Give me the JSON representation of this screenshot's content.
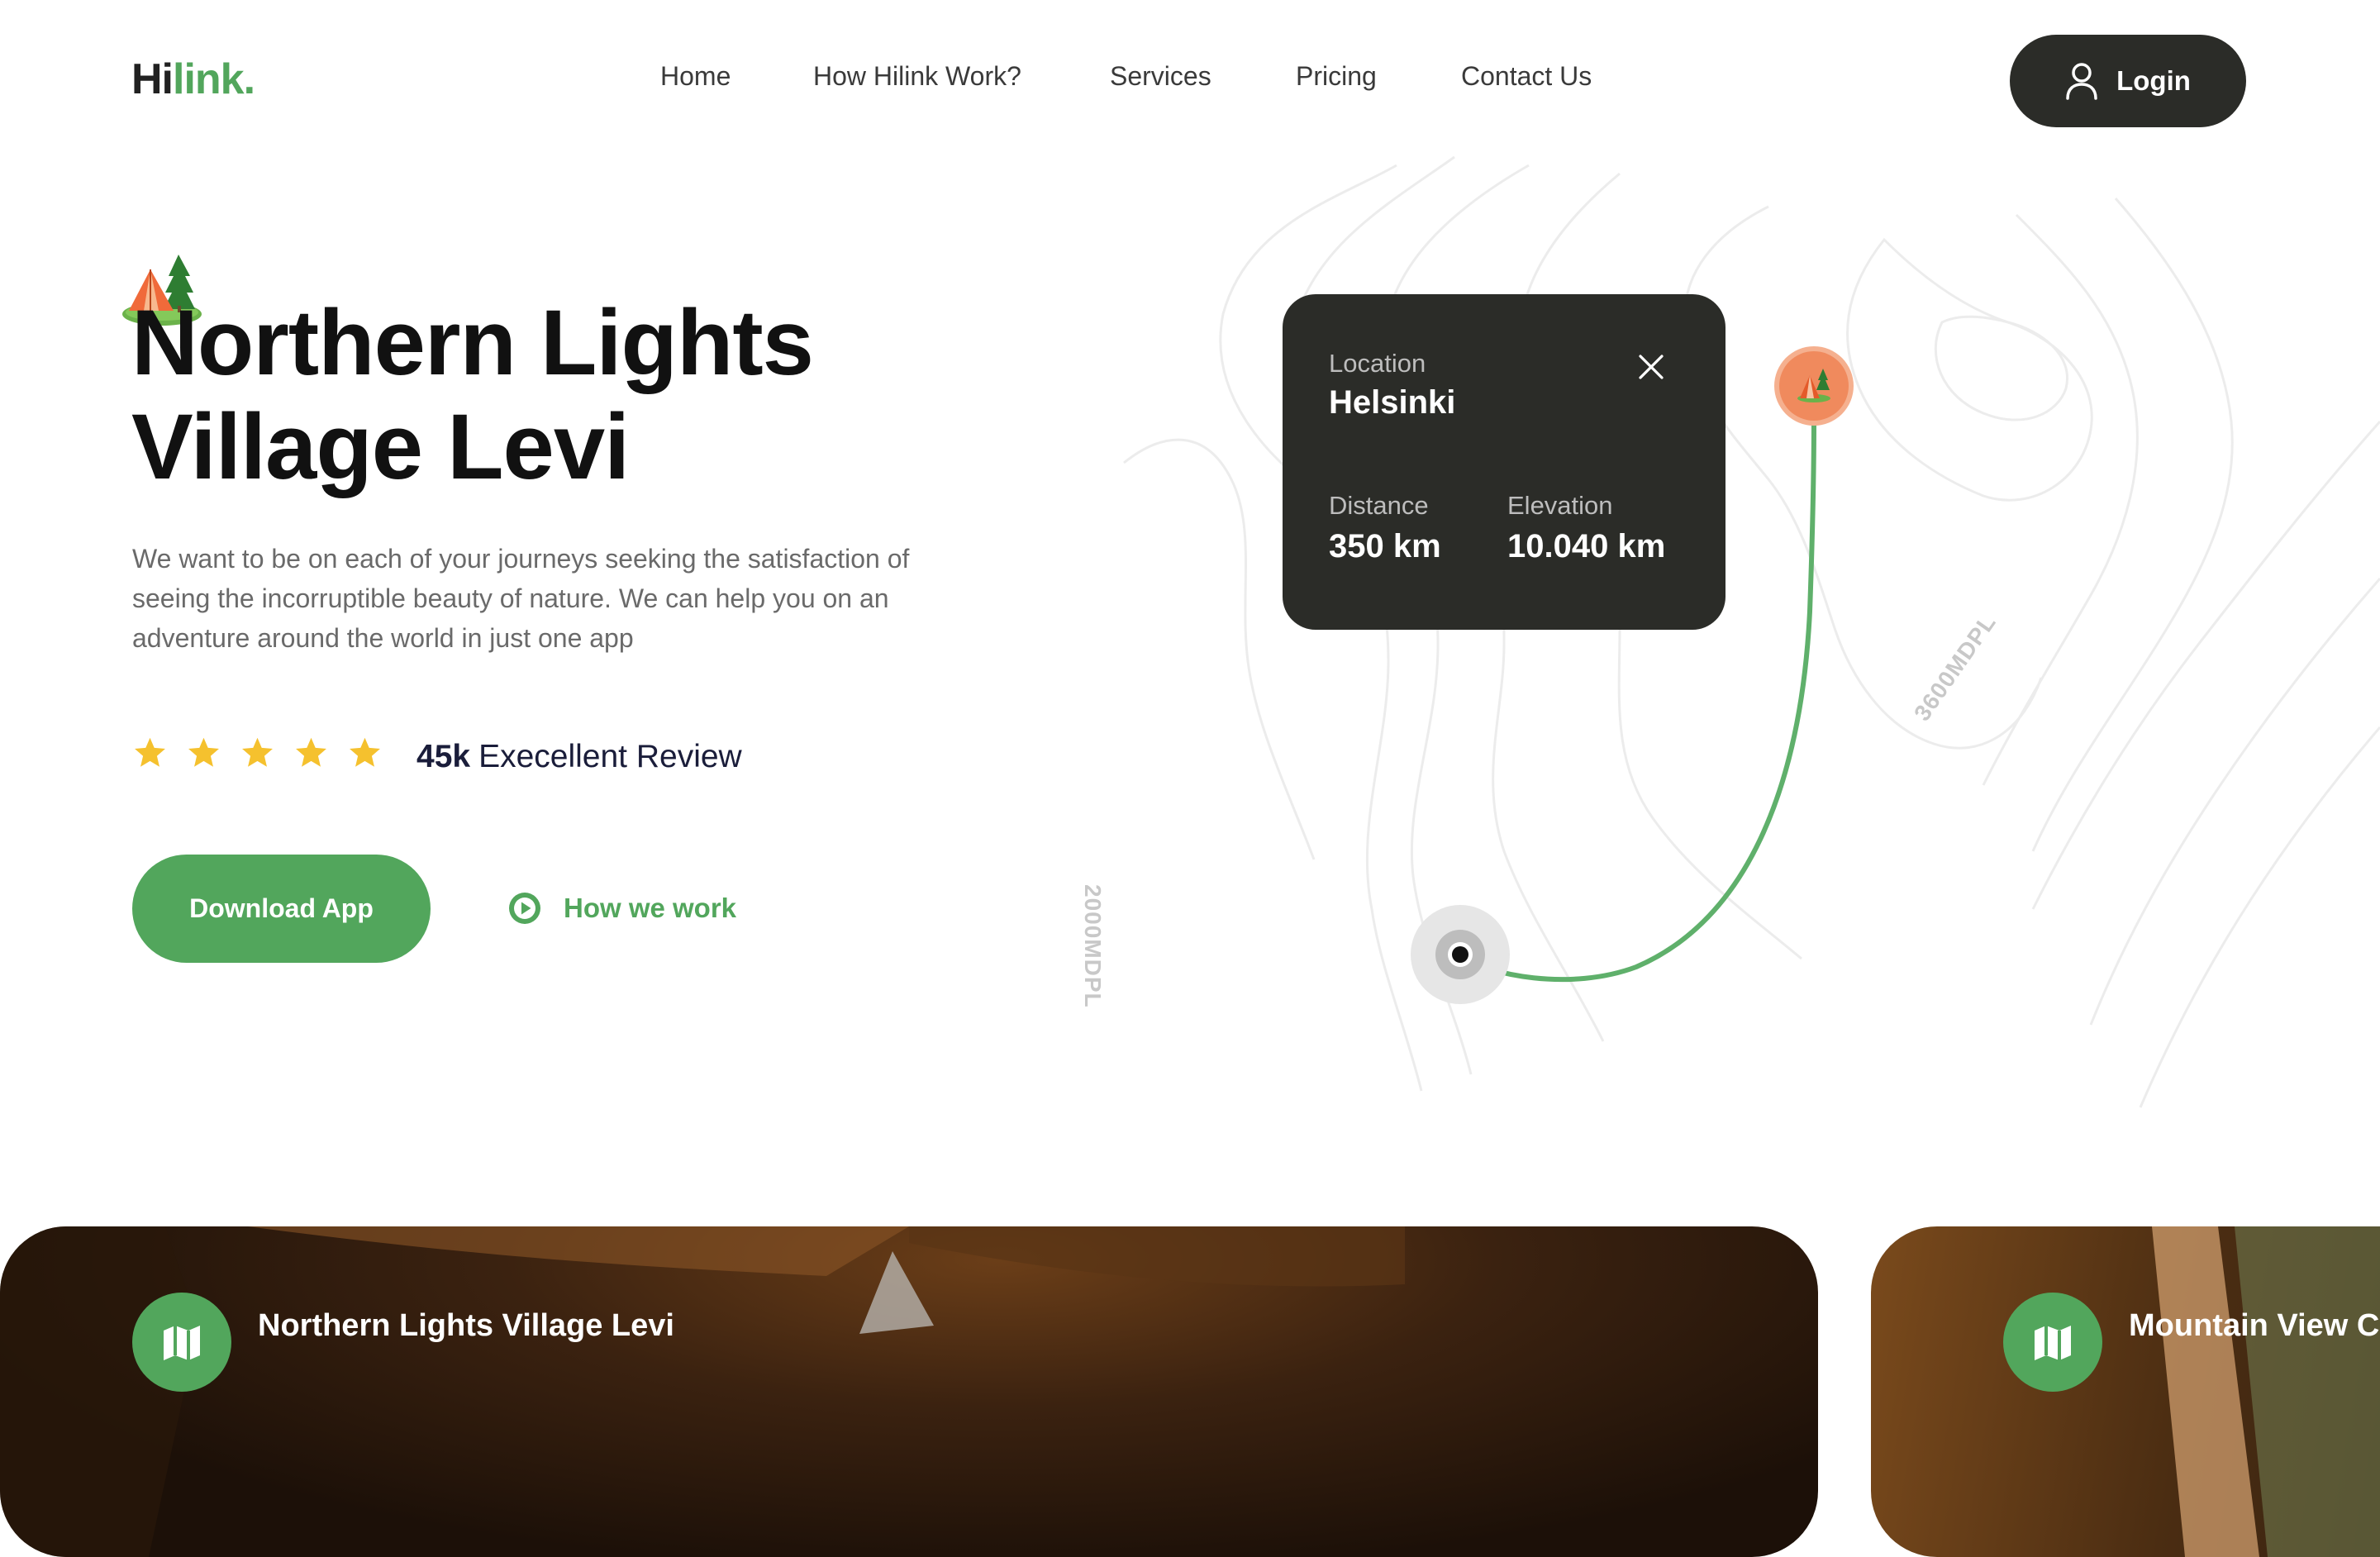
{
  "header": {
    "logo_hi": "Hi",
    "logo_link": "link.",
    "nav": [
      "Home",
      "How Hilink Work?",
      "Services",
      "Pricing",
      "Contact Us"
    ],
    "login_label": "Login"
  },
  "hero": {
    "title_line1": "Northern Lights",
    "title_line2": "Village Levi",
    "description": "We want to be on each of your journeys seeking the satisfaction of seeing the incorruptible beauty of nature. We can help you on an adventure around the world in just one app",
    "rating_stars": 5,
    "review_count": "45k",
    "review_text": "Execellent Review",
    "download_label": "Download App",
    "how_we_work_label": "How we work"
  },
  "map": {
    "elevation_labels": [
      "2000MDPL",
      "3600MDPL"
    ],
    "card": {
      "location_label": "Location",
      "location_value": "Helsinki",
      "distance_label": "Distance",
      "distance_value": "350 km",
      "elevation_label": "Elevation",
      "elevation_value": "10.040 km"
    },
    "pin_icon": "tent-icon"
  },
  "cards": [
    {
      "title": "Northern Lights Village Levi",
      "icon": "map-icon"
    },
    {
      "title": "Mountain View Ca",
      "icon": "map-icon"
    }
  ],
  "colors": {
    "brand_green": "#52a65c",
    "dark": "#2b2c28",
    "star": "#f5c12e",
    "pin": "#f08a5d"
  }
}
